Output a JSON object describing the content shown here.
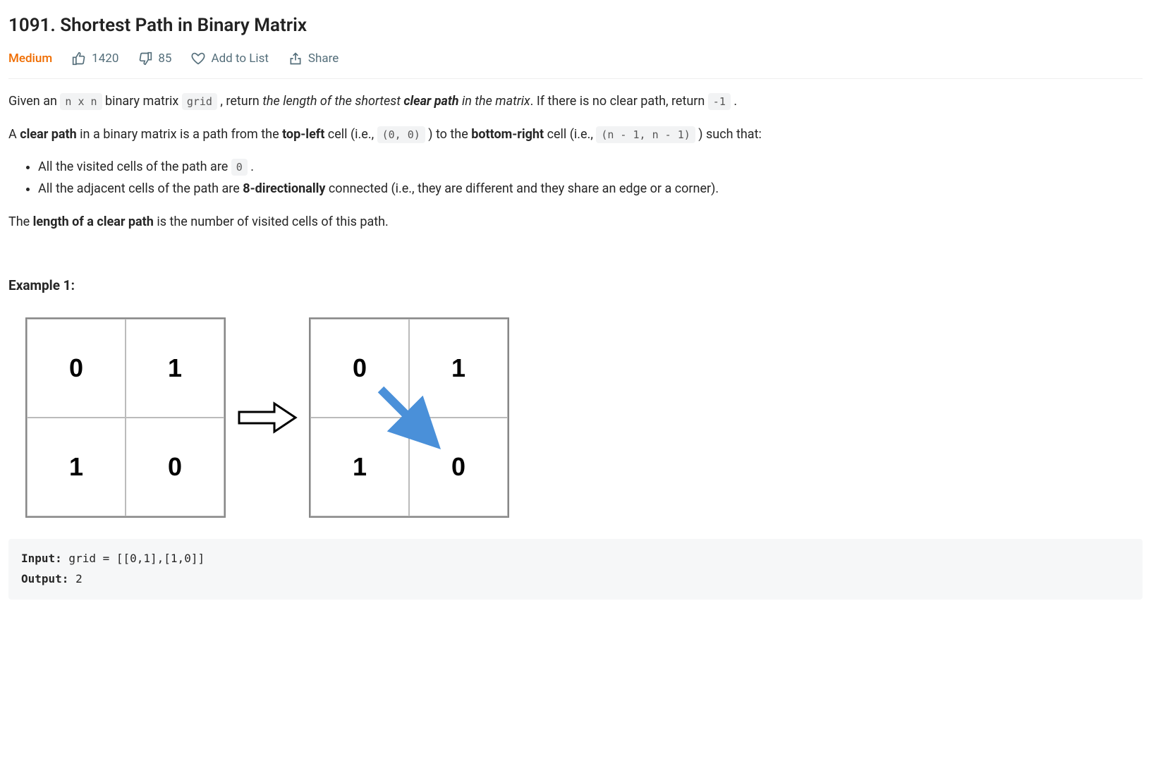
{
  "title": "1091. Shortest Path in Binary Matrix",
  "difficulty": "Medium",
  "stats": {
    "upvotes": "1420",
    "downvotes": "85",
    "add_to_list": "Add to List",
    "share": "Share"
  },
  "body": {
    "p1_pre": "Given an ",
    "code_nxn": "n x n",
    "p1_mid1": " binary matrix ",
    "code_grid": "grid",
    "p1_mid2": " , return ",
    "p1_em": "the length of the shortest ",
    "p1_strong": "clear path",
    "p1_em2": " in the matrix",
    "p1_after": ". If there is no clear path, return ",
    "code_neg1": "-1",
    "p1_end": " .",
    "p2_a": "A ",
    "p2_b": "clear path",
    "p2_c": " in a binary matrix is a path from the ",
    "p2_d": "top-left",
    "p2_e": " cell (i.e., ",
    "code_00": "(0, 0)",
    "p2_f": " ) to the ",
    "p2_g": "bottom-right",
    "p2_h": " cell (i.e., ",
    "code_n1": "(n - 1, n - 1)",
    "p2_i": " ) such that:",
    "li1_a": "All the visited cells of the path are ",
    "code_0": "0",
    "li1_b": " .",
    "li2_a": "All the adjacent cells of the path are ",
    "li2_b": "8-directionally",
    "li2_c": " connected (i.e., they are different and they share an edge or a corner).",
    "p3_a": "The ",
    "p3_b": "length of a clear path",
    "p3_c": " is the number of visited cells of this path."
  },
  "example": {
    "heading": "Example 1:",
    "matrix": [
      [
        "0",
        "1"
      ],
      [
        "1",
        "0"
      ]
    ],
    "io_input_label": "Input:",
    "io_input_value": " grid = [[0,1],[1,0]]",
    "io_output_label": "Output:",
    "io_output_value": " 2"
  }
}
